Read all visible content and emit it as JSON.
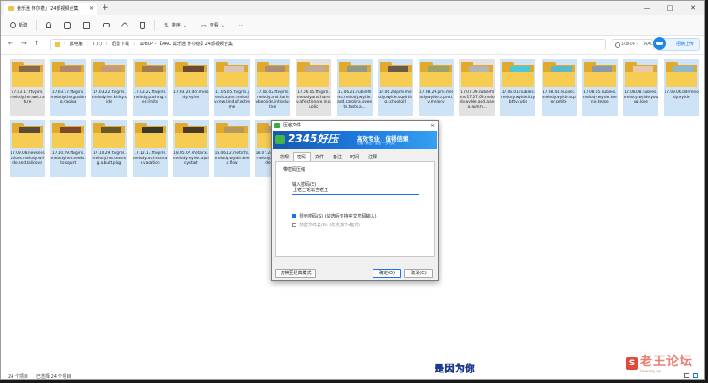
{
  "window": {
    "tab_title": "姜乐迷 怀尔德」 24部视频合集",
    "new_tab": "+",
    "controls": [
      "—",
      "□",
      "✕"
    ]
  },
  "toolbar": {
    "new": "新建",
    "sort": "排序",
    "view": "查看",
    "more": "···"
  },
  "address": {
    "crumbs": [
      "此电脑",
      "I (I:)",
      "迅雷下载",
      "1080P - 【AAC 莫乐迷 怀尔德】24部视频合集"
    ],
    "search_placeholder": "1080P - 【AAC",
    "upload_label": "招精上传"
  },
  "files": [
    {
      "name": "17.03.17.ftvgirls.melody.her.wet.nature",
      "color": "#8a6a4a"
    },
    {
      "name": "17.03.17.ftvgirls.melody.the.gushing.vagina",
      "color": "#b4876a"
    },
    {
      "name": "17.03.22.ftvgirls.melody.her.kinky.side",
      "color": "#c79a7a"
    },
    {
      "name": "17.03.22.ftvgirls.melody.pushing.her.limits",
      "color": "#9e7a55"
    },
    {
      "name": "17.03.28.ddr.melody.wylde",
      "color": "#6a4a32"
    },
    {
      "name": "17.05.05.ftvgirls.jessica.and.melody.new.kind.of.extreme",
      "color": "#d9c6b5"
    },
    {
      "name": "17.06.02.ftvgirls.melody.and.harley.bedside.introduction",
      "color": "#a98f7a"
    },
    {
      "name": "17.06.05.ftvgirls.melody.and.harley.affectionate.in.public",
      "color": "#c2a995"
    },
    {
      "name": "17.06.21.nubilefilms.melody.wylde.and.carolina.sweets.taste.a...",
      "color": "#8f9a8a"
    },
    {
      "name": "17.06.28.pmi.melody.wylde.squirting.schoolgirl",
      "color": "#6a5a4a"
    },
    {
      "name": "17.08.29.pmi.melody.wylde.a.pretty.melody",
      "color": "#9aa36a"
    },
    {
      "name": "17.07.09.nubilefilms.17.07.09.melody.wylde.and.alana.summ...",
      "color": "#b5b5b5"
    },
    {
      "name": "17.08.01.nubiles.melody.wylde.itty.bitty.cutie",
      "color": "#4ec7d8"
    },
    {
      "name": "17.08.04.nubiles.melody.wylde.super.petite",
      "color": "#5ab8c8"
    },
    {
      "name": "17.08.05.nubiles.melody.wylde.teenie.tease",
      "color": "#8a9aa8"
    },
    {
      "name": "17.08.08.nubiles.melody.wylde.young.love",
      "color": "#e7c9b0"
    },
    {
      "name": "17.09.06.ddr.melody.wylde",
      "color": "#8fb8c8"
    },
    {
      "name": "17.09.08.newsensations.melody.wylde.and.talidova",
      "color": "#5a4a3a"
    },
    {
      "name": "17.10.29.ftvgirls.melody.her.needs.to.squirt",
      "color": "#7a4a2a"
    },
    {
      "name": "17.10.29.ftvgirls.melody.her.teasing.a.butt.plug",
      "color": "#6a5a2a"
    },
    {
      "name": "17.12.17.ftvgirls.melody.a.christmas.vacation",
      "color": "#3a3a2a"
    },
    {
      "name": "18.05.07.metartx.melody.wylde.a.juicy.start",
      "color": "#4a3a2a"
    },
    {
      "name": "18.06.12.metarts.melody.wylde.deep.flow",
      "color": "#b49a5a"
    },
    {
      "name": "18.07.24.metartx.melody.wylde.hidden.vol",
      "color": "#c9a66a"
    }
  ],
  "dialog": {
    "title": "压缩文件",
    "close": "✕",
    "banner_brand": "2345好压",
    "banner_slogan": "高效专业，值得信赖",
    "banner_sub": "压缩 / 解压 / 加密 一步完成",
    "tabs": [
      "常规",
      "密码",
      "文件",
      "备注",
      "时间",
      "注释"
    ],
    "active_tab": 1,
    "group_title": "带密码压缩",
    "password_label": "输入密码(E)",
    "password_value": "上老王论坛当老王",
    "show_password": "显示密码(S)  (勾选后支持中文密码输入)",
    "encrypt_names": "加密文件名(N)  (仅支持7z格式)",
    "switch_mode": "切换至经典模式",
    "ok": "确定(O)",
    "cancel": "取消(C)"
  },
  "status": {
    "count": "24 个项目",
    "selected": "已选择 24 个项目"
  },
  "overlay": {
    "subtitle": "是因为你",
    "watermark": "老王论坛",
    "watermark_sub": "laowang.vip",
    "watermark_logo": "S"
  }
}
